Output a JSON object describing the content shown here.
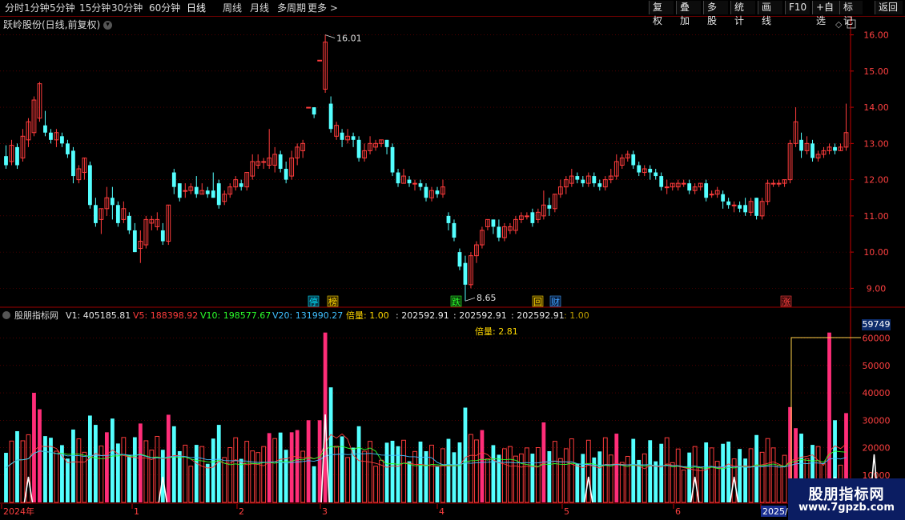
{
  "toolbar": {
    "periods": [
      "分时",
      "1分钟",
      "5分钟",
      "15分钟",
      "30分钟",
      "60分钟",
      "日线",
      "周线",
      "月线",
      "多周期",
      "更多 >"
    ],
    "active": "日线",
    "right_buttons": [
      "复权",
      "叠加",
      "多股",
      "统计",
      "画线",
      "F10",
      "+自选",
      "标记",
      "返回"
    ]
  },
  "main": {
    "title": "跃岭股份(日线,前复权)",
    "high_label": "16.01",
    "low_label": "8.65",
    "price_axis": [
      "16.00",
      "15.00",
      "14.00",
      "13.00",
      "12.00",
      "11.00",
      "10.00",
      "9.00"
    ],
    "markers": [
      {
        "text": "停",
        "color": "#00e5ff",
        "bg": "#08384a"
      },
      {
        "text": "榜",
        "color": "#ffd700",
        "bg": "#3a2c00"
      },
      {
        "text": "跌",
        "color": "#2bff2b",
        "bg": "#0a3a0a"
      },
      {
        "text": "回",
        "color": "#ffd700",
        "bg": "#3a2c00"
      },
      {
        "text": "财",
        "color": "#40a0ff",
        "bg": "#0a2040"
      },
      {
        "text": "涨",
        "color": "#ff4040",
        "bg": "#3a0a0a"
      }
    ]
  },
  "indicator": {
    "name": "股朋指标网",
    "v1": "V1: 405185.81",
    "v5": "V5: 188398.92",
    "v10": "V10: 198577.67",
    "v20": "V20: 131990.27",
    "ratio": "倍量: 1.00",
    "extra1": ": 202592.91",
    "extra2": ": 202592.91",
    "extra3": ": 202592.91",
    "extra4": ": 1.00",
    "ratio_label": "倍量: 2.81",
    "cursor_value": "59749",
    "axis": [
      "60000",
      "50000",
      "40000",
      "30000",
      "20000",
      "10000"
    ]
  },
  "x_axis": [
    "2024年",
    "1",
    "2",
    "3",
    "4",
    "5",
    "6",
    "2025/"
  ],
  "watermark": {
    "line1": "股朋指标网",
    "line2": "www.7gpzb.com"
  },
  "colors": {
    "up": "#ff3c3c",
    "down": "#54ffff",
    "pink": "#ff2d78",
    "grid": "#7a0000",
    "axis": "#c80000"
  },
  "chart_data": {
    "type": "candlestick",
    "price_range": [
      8.5,
      16.3
    ],
    "candles": [
      [
        12.65,
        12.4,
        12.95,
        12.3
      ],
      [
        12.5,
        12.95,
        13.1,
        12.4
      ],
      [
        12.9,
        12.4,
        13.0,
        12.3
      ],
      [
        12.6,
        13.2,
        13.4,
        12.5
      ],
      [
        13.1,
        13.6,
        13.7,
        12.9
      ],
      [
        13.3,
        14.2,
        14.3,
        13.2
      ],
      [
        13.7,
        14.65,
        14.7,
        13.6
      ],
      [
        13.5,
        13.3,
        13.9,
        13.2
      ],
      [
        13.3,
        13.1,
        13.4,
        13.0
      ],
      [
        13.1,
        13.3,
        13.4,
        12.9
      ],
      [
        13.2,
        13.0,
        13.3,
        12.9
      ],
      [
        13.0,
        12.7,
        13.1,
        12.6
      ],
      [
        12.8,
        12.1,
        12.9,
        11.9
      ],
      [
        12.0,
        12.3,
        12.4,
        11.9
      ],
      [
        12.2,
        12.6,
        12.6,
        12.0
      ],
      [
        12.4,
        11.3,
        12.5,
        11.2
      ],
      [
        11.3,
        10.8,
        11.5,
        10.7
      ],
      [
        10.9,
        11.2,
        11.2,
        10.5
      ],
      [
        11.2,
        11.5,
        11.8,
        11.0
      ],
      [
        11.5,
        11.3,
        11.8,
        10.9
      ],
      [
        11.3,
        10.8,
        11.4,
        10.7
      ],
      [
        10.9,
        11.2,
        11.4,
        10.8
      ],
      [
        11.0,
        10.6,
        11.1,
        10.5
      ],
      [
        10.6,
        10.0,
        10.8,
        10.0
      ],
      [
        10.1,
        10.3,
        10.6,
        9.7
      ],
      [
        10.2,
        10.9,
        11.0,
        10.1
      ],
      [
        10.8,
        10.9,
        11.0,
        10.6
      ],
      [
        10.7,
        10.9,
        11.1,
        10.6
      ],
      [
        10.6,
        10.3,
        10.8,
        10.2
      ],
      [
        10.3,
        11.3,
        11.3,
        10.2
      ],
      [
        12.2,
        11.8,
        12.3,
        11.6
      ],
      [
        11.9,
        11.5,
        11.9,
        11.4
      ],
      [
        11.7,
        11.7,
        11.9,
        11.5
      ],
      [
        11.7,
        11.8,
        11.9,
        11.6
      ],
      [
        11.8,
        11.6,
        12.1,
        11.5
      ],
      [
        11.6,
        11.7,
        11.9,
        11.6
      ],
      [
        11.7,
        11.6,
        11.8,
        11.5
      ],
      [
        11.7,
        11.5,
        12.2,
        11.5
      ],
      [
        11.9,
        11.3,
        12.0,
        11.2
      ],
      [
        11.4,
        11.6,
        11.7,
        11.3
      ],
      [
        11.6,
        11.8,
        11.9,
        11.5
      ],
      [
        11.8,
        12.0,
        12.1,
        11.7
      ],
      [
        11.9,
        11.8,
        12.0,
        11.7
      ],
      [
        11.8,
        12.2,
        12.2,
        11.7
      ],
      [
        12.1,
        12.5,
        12.7,
        12.0
      ],
      [
        12.4,
        12.5,
        12.7,
        12.3
      ],
      [
        12.5,
        12.5,
        12.6,
        12.3
      ],
      [
        12.4,
        12.6,
        13.4,
        12.3
      ],
      [
        12.4,
        12.7,
        12.9,
        12.2
      ],
      [
        12.7,
        12.3,
        12.8,
        12.2
      ],
      [
        12.3,
        12.0,
        12.5,
        11.9
      ],
      [
        12.1,
        12.6,
        12.8,
        12.0
      ],
      [
        12.6,
        12.9,
        13.0,
        12.4
      ],
      [
        12.8,
        13.0,
        13.1,
        12.6
      ],
      [
        14.0,
        14.0,
        14.0,
        14.0
      ],
      [
        14.0,
        13.8,
        14.0,
        13.7
      ],
      [
        15.3,
        15.3,
        15.3,
        15.3
      ],
      [
        14.5,
        15.8,
        16.0,
        14.4
      ],
      [
        14.1,
        13.4,
        14.3,
        13.3
      ],
      [
        13.2,
        13.5,
        13.6,
        13.1
      ],
      [
        13.3,
        13.1,
        13.4,
        12.9
      ],
      [
        13.1,
        13.2,
        13.4,
        13.0
      ],
      [
        13.2,
        13.1,
        13.3,
        12.9
      ],
      [
        13.1,
        12.6,
        13.2,
        12.5
      ],
      [
        12.6,
        12.8,
        13.0,
        12.5
      ],
      [
        12.8,
        13.0,
        13.2,
        12.7
      ],
      [
        12.9,
        13.0,
        13.1,
        12.8
      ],
      [
        13.0,
        13.1,
        13.1,
        12.9
      ],
      [
        13.1,
        12.9,
        13.1,
        12.7
      ],
      [
        12.9,
        12.2,
        13.0,
        12.1
      ],
      [
        12.2,
        11.9,
        12.3,
        11.8
      ],
      [
        11.9,
        12.1,
        12.3,
        11.9
      ],
      [
        12.0,
        11.9,
        12.1,
        11.8
      ],
      [
        11.9,
        11.9,
        12.0,
        11.7
      ],
      [
        11.9,
        11.8,
        12.0,
        11.7
      ],
      [
        11.8,
        11.5,
        11.9,
        11.4
      ],
      [
        11.5,
        11.7,
        11.8,
        11.4
      ],
      [
        11.7,
        11.6,
        11.8,
        11.5
      ],
      [
        11.6,
        11.8,
        12.0,
        11.5
      ],
      [
        11.0,
        10.8,
        11.1,
        10.6
      ],
      [
        10.8,
        10.4,
        10.9,
        10.3
      ],
      [
        10.0,
        9.6,
        10.1,
        9.5
      ],
      [
        9.7,
        9.1,
        9.9,
        8.65
      ],
      [
        9.1,
        9.9,
        10.0,
        9.0
      ],
      [
        9.9,
        10.2,
        10.3,
        9.7
      ],
      [
        10.2,
        10.6,
        10.7,
        10.1
      ],
      [
        10.7,
        10.9,
        10.9,
        10.6
      ],
      [
        10.9,
        10.7,
        10.9,
        10.5
      ],
      [
        10.7,
        10.4,
        10.9,
        10.3
      ],
      [
        10.4,
        10.7,
        10.8,
        10.3
      ],
      [
        10.6,
        10.7,
        10.8,
        10.5
      ],
      [
        10.6,
        10.9,
        11.0,
        10.5
      ],
      [
        10.9,
        11.0,
        11.1,
        10.8
      ],
      [
        11.0,
        11.0,
        11.1,
        10.9
      ],
      [
        11.1,
        10.8,
        11.2,
        10.7
      ],
      [
        10.9,
        11.1,
        11.2,
        10.8
      ],
      [
        11.0,
        11.3,
        11.7,
        10.9
      ],
      [
        11.3,
        11.2,
        11.5,
        11.0
      ],
      [
        11.2,
        11.6,
        11.6,
        11.1
      ],
      [
        11.6,
        11.8,
        12.0,
        11.5
      ],
      [
        11.8,
        12.0,
        12.1,
        11.6
      ],
      [
        11.9,
        12.1,
        12.3,
        11.8
      ],
      [
        12.1,
        12.0,
        12.2,
        11.9
      ],
      [
        12.0,
        11.9,
        12.1,
        11.8
      ],
      [
        11.9,
        12.1,
        12.2,
        11.8
      ],
      [
        12.1,
        11.9,
        12.2,
        11.8
      ],
      [
        11.9,
        11.8,
        12.0,
        11.7
      ],
      [
        11.8,
        12.0,
        12.1,
        11.7
      ],
      [
        12.0,
        12.1,
        12.3,
        11.9
      ],
      [
        12.1,
        12.5,
        12.7,
        12.0
      ],
      [
        12.4,
        12.6,
        12.7,
        12.3
      ],
      [
        12.6,
        12.7,
        12.8,
        12.5
      ],
      [
        12.7,
        12.4,
        12.8,
        12.3
      ],
      [
        12.4,
        12.2,
        12.5,
        12.1
      ],
      [
        12.2,
        12.3,
        12.4,
        12.1
      ],
      [
        12.3,
        12.2,
        12.4,
        12.0
      ],
      [
        12.2,
        12.1,
        12.3,
        12.0
      ],
      [
        12.1,
        11.8,
        12.2,
        11.7
      ],
      [
        11.8,
        11.8,
        12.0,
        11.6
      ],
      [
        11.8,
        11.9,
        11.9,
        11.7
      ],
      [
        11.8,
        11.9,
        12.0,
        11.7
      ],
      [
        11.9,
        11.9,
        12.0,
        11.8
      ],
      [
        11.9,
        11.7,
        12.0,
        11.6
      ],
      [
        11.7,
        11.8,
        11.9,
        11.6
      ],
      [
        11.8,
        11.9,
        11.9,
        11.7
      ],
      [
        11.9,
        11.5,
        12.0,
        11.4
      ],
      [
        11.6,
        11.6,
        11.7,
        11.5
      ],
      [
        11.6,
        11.7,
        11.8,
        11.5
      ],
      [
        11.6,
        11.4,
        11.7,
        11.2
      ],
      [
        11.4,
        11.3,
        11.5,
        11.2
      ],
      [
        11.3,
        11.3,
        11.4,
        11.1
      ],
      [
        11.3,
        11.2,
        11.4,
        11.1
      ],
      [
        11.3,
        11.1,
        11.5,
        11.0
      ],
      [
        11.1,
        11.4,
        11.5,
        11.0
      ],
      [
        11.5,
        11.0,
        11.5,
        10.9
      ],
      [
        11.0,
        11.4,
        11.5,
        10.9
      ],
      [
        11.4,
        11.9,
        12.0,
        11.3
      ],
      [
        11.9,
        11.9,
        12.0,
        11.8
      ],
      [
        11.9,
        11.9,
        12.0,
        11.8
      ],
      [
        11.9,
        12.0,
        12.0,
        11.8
      ],
      [
        12.0,
        13.0,
        13.1,
        11.9
      ],
      [
        13.0,
        13.6,
        14.0,
        12.9
      ],
      [
        13.1,
        12.8,
        13.3,
        12.6
      ],
      [
        12.8,
        13.0,
        13.2,
        12.7
      ],
      [
        13.0,
        12.6,
        13.1,
        12.5
      ],
      [
        12.6,
        12.7,
        12.8,
        12.5
      ],
      [
        12.7,
        12.8,
        12.9,
        12.6
      ],
      [
        12.8,
        12.9,
        13.0,
        12.7
      ],
      [
        12.9,
        12.8,
        13.0,
        12.7
      ],
      [
        12.8,
        12.9,
        13.0,
        12.8
      ],
      [
        12.9,
        13.3,
        14.1,
        12.8
      ]
    ]
  }
}
